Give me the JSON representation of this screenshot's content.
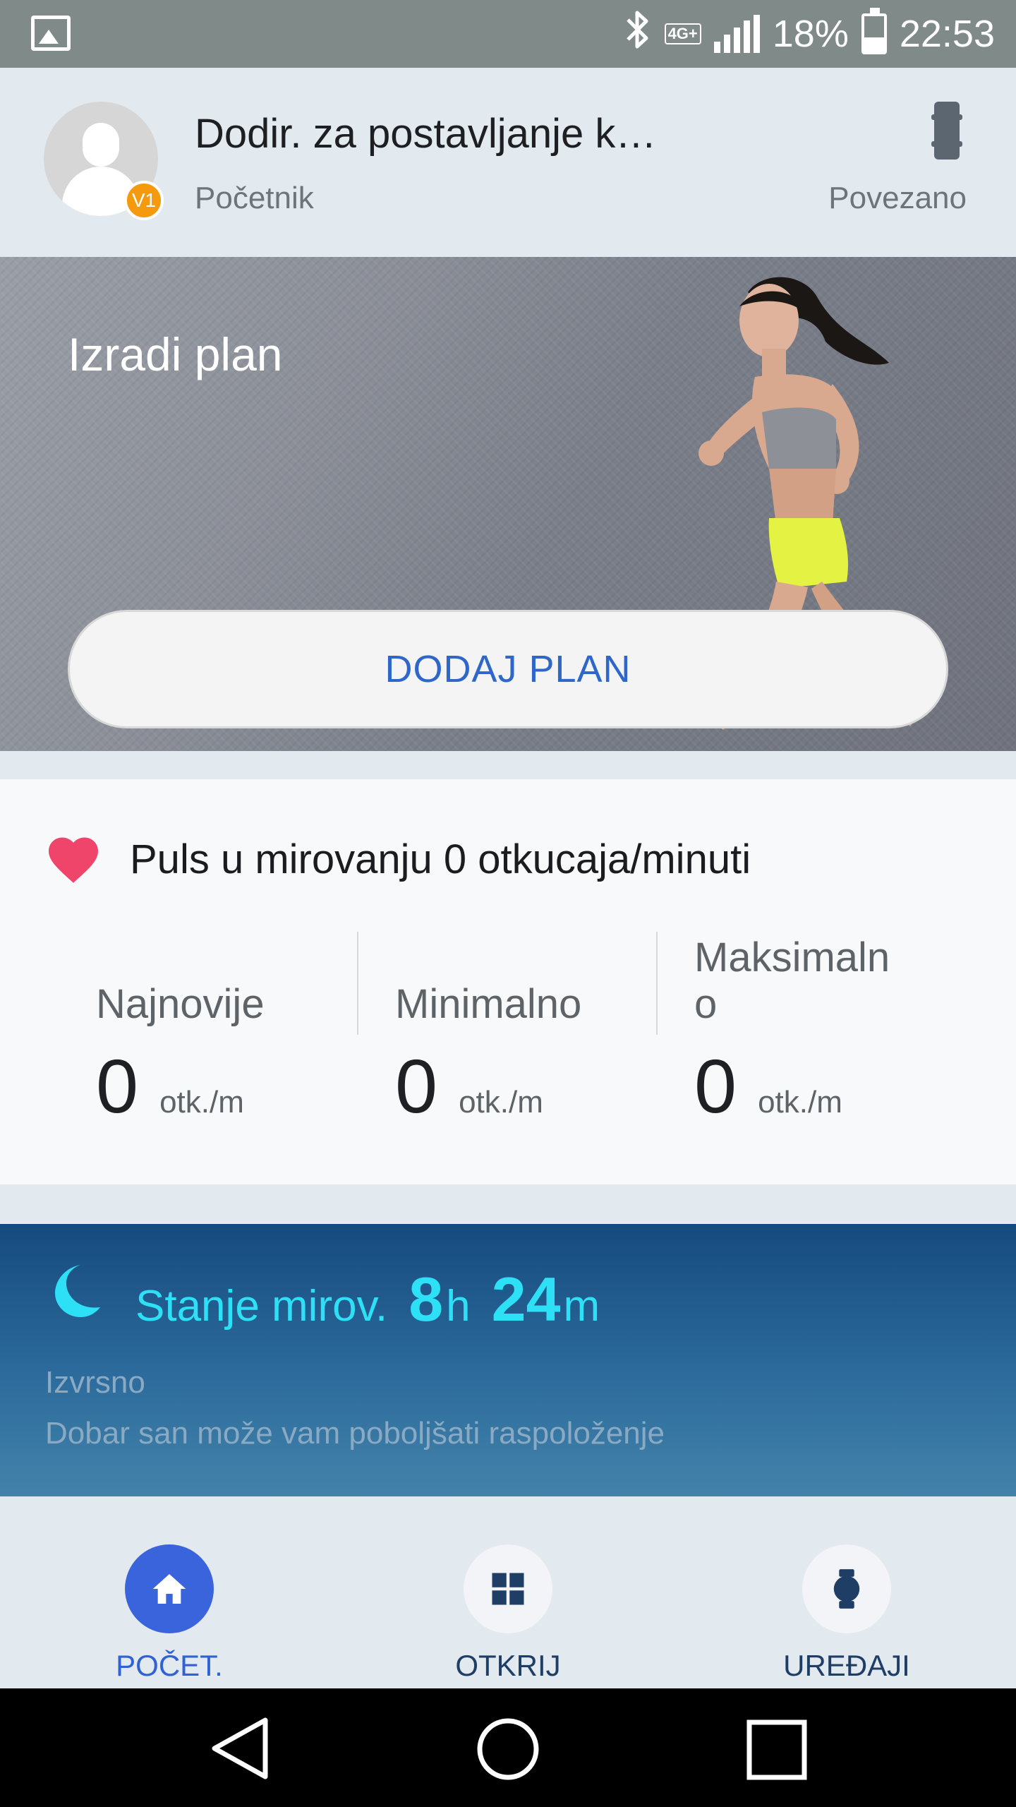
{
  "status_bar": {
    "battery": "18%",
    "time": "22:53",
    "network": "4G+",
    "icons": [
      "gallery-icon",
      "bluetooth-icon",
      "network-4g-icon",
      "signal-icon",
      "battery-icon"
    ]
  },
  "header": {
    "title": "Dodir. za postavljanje k…",
    "level": "V1",
    "rank": "Početnik",
    "device_status": "Povezano"
  },
  "plan": {
    "title": "Izradi plan",
    "button_label": "DODAJ PLAN"
  },
  "heart_rate": {
    "title": "Puls u mirovanju 0 otkucaja/minuti",
    "columns": [
      {
        "label": "Najnovije",
        "value": "0",
        "unit": "otk./m"
      },
      {
        "label": "Minimalno",
        "value": "0",
        "unit": "otk./m"
      },
      {
        "label_line1": "Maksimaln",
        "label_line2": "o",
        "value": "0",
        "unit": "otk./m"
      }
    ],
    "heart_color": "#f0456b"
  },
  "sleep": {
    "label": "Stanje mirov.",
    "hours": "8",
    "hours_unit": "h",
    "minutes": "24",
    "minutes_unit": "m",
    "quality": "Izvrsno",
    "tip": "Dobar san može vam poboljšati raspoloženje",
    "accent": "#2de0f5"
  },
  "bottom_nav": {
    "items": [
      {
        "label": "POČET.",
        "icon": "home-icon",
        "active": true
      },
      {
        "label": "OTKRIJ",
        "icon": "grid-icon",
        "active": false
      },
      {
        "label": "UREĐAJI",
        "icon": "watch-icon",
        "active": false
      }
    ],
    "active_color": "#3a64dc"
  },
  "system_nav": {
    "icons": [
      "back-icon",
      "home-circle-icon",
      "recents-icon"
    ]
  }
}
